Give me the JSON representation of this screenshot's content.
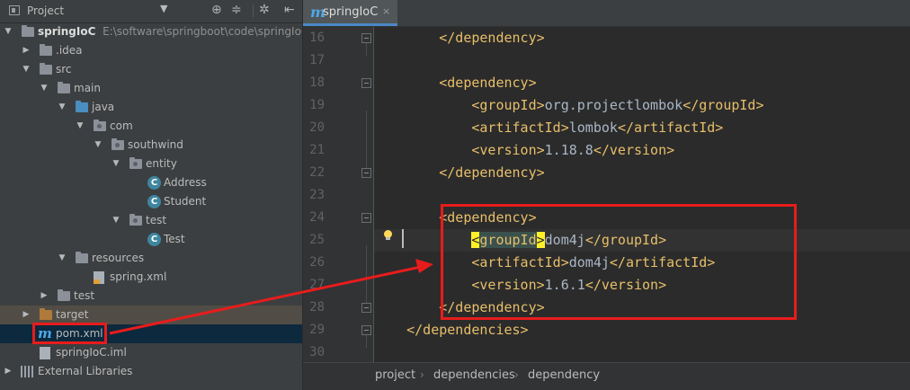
{
  "panel": {
    "title": "Project",
    "dropdown_icon": "chevron-down-icon",
    "toolbar_icons": [
      "locate-icon",
      "collapse-all-icon",
      "gear-icon",
      "hide-icon"
    ]
  },
  "tree": {
    "root_name": "springIoC",
    "root_path": "E:\\software\\springboot\\code\\springIoC",
    "idea": ".idea",
    "src": "src",
    "main": "main",
    "java": "java",
    "com": "com",
    "southwind": "southwind",
    "entity": "entity",
    "address": "Address",
    "student": "Student",
    "test_pkg": "test",
    "test_class": "Test",
    "resources": "resources",
    "spring_xml": "spring.xml",
    "test_dir": "test",
    "target": "target",
    "pom": "pom.xml",
    "iml": "springIoC.iml",
    "ext_libs": "External Libraries"
  },
  "editor": {
    "tab_label": "springIoC",
    "tab_close": "×",
    "lines": [
      {
        "n": "16",
        "text": "        </dependency>"
      },
      {
        "n": "17",
        "text": ""
      },
      {
        "n": "18",
        "text": "        <dependency>"
      },
      {
        "n": "19",
        "text": "            <groupId>org.projectlombok</groupId>"
      },
      {
        "n": "20",
        "text": "            <artifactId>lombok</artifactId>"
      },
      {
        "n": "21",
        "text": "            <version>1.18.8</version>"
      },
      {
        "n": "22",
        "text": "        </dependency>"
      },
      {
        "n": "23",
        "text": ""
      },
      {
        "n": "24",
        "text": "        <dependency>"
      },
      {
        "n": "25",
        "text": "            <groupId>dom4j</groupId>"
      },
      {
        "n": "26",
        "text": "            <artifactId>dom4j</artifactId>"
      },
      {
        "n": "27",
        "text": "            <version>1.6.1</version>"
      },
      {
        "n": "28",
        "text": "        </dependency>"
      },
      {
        "n": "29",
        "text": "    </dependencies>"
      },
      {
        "n": "30",
        "text": ""
      }
    ],
    "breadcrumb": [
      "project",
      "dependencies",
      "dependency"
    ]
  },
  "colors": {
    "tag": "#e8bf6a",
    "text": "#a9b7c6",
    "annotation": "#e81c1c",
    "maven_icon": "#4fa8e8"
  }
}
